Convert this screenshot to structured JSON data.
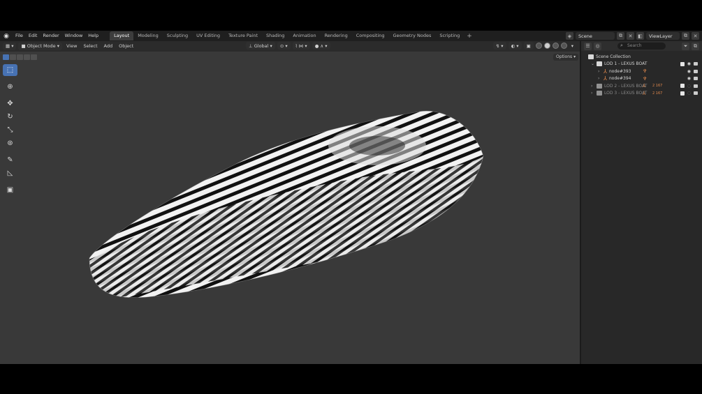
{
  "menubar": {
    "items": [
      "File",
      "Edit",
      "Render",
      "Window",
      "Help"
    ]
  },
  "workspaces": {
    "tabs": [
      "Layout",
      "Modeling",
      "Sculpting",
      "UV Editing",
      "Texture Paint",
      "Shading",
      "Animation",
      "Rendering",
      "Compositing",
      "Geometry Nodes",
      "Scripting"
    ],
    "active": "Layout",
    "add_label": "+"
  },
  "scene": {
    "name": "Scene",
    "view_layer": "ViewLayer"
  },
  "viewport_header": {
    "mode": "Object Mode",
    "menus": [
      "View",
      "Select",
      "Add",
      "Object"
    ],
    "orientation": "Global",
    "options": "Options"
  },
  "outliner": {
    "search_placeholder": "Search",
    "rows": [
      {
        "label": "Scene Collection",
        "level": 0,
        "dim": false
      },
      {
        "label": "LOD 1 - LEXUS BOAT",
        "level": 1,
        "dim": false
      },
      {
        "label": "node#393",
        "level": 2,
        "dim": false
      },
      {
        "label": "node#394",
        "level": 2,
        "dim": false
      },
      {
        "label": "LOD 2 - LEXUS BOAT",
        "level": 1,
        "dim": true,
        "badge": "2 167"
      },
      {
        "label": "LOD 3 - LEXUS BOAT",
        "level": 1,
        "dim": true,
        "badge": "2 167"
      }
    ]
  },
  "colors": {
    "active_tab": "#3d3d3d",
    "accent": "#4772b3",
    "object_icon": "#e0884c",
    "viewport_bg": "#393939"
  }
}
